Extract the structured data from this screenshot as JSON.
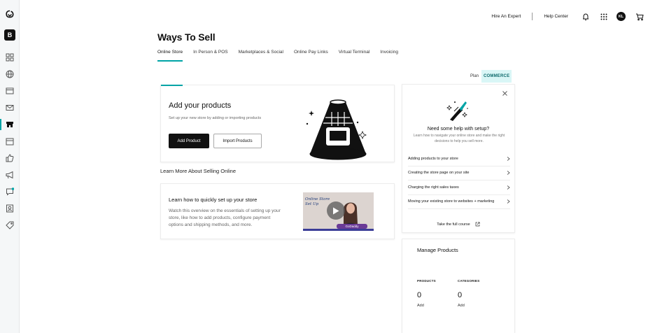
{
  "sidebar": {
    "brand_letter": "B",
    "icons": [
      "grid-icon",
      "globe-icon",
      "browser-icon",
      "mail-icon",
      "store-icon",
      "calendar-icon",
      "thumbs-up-icon",
      "megaphone-icon",
      "chat-icon",
      "contact-icon",
      "tag-icon"
    ],
    "active": "store-icon"
  },
  "header": {
    "hire_expert": "Hire An Expert",
    "help_center": "Help Center",
    "avatar_initials": "KL"
  },
  "page": {
    "title": "Ways To Sell",
    "tabs": [
      {
        "label": "Online Store",
        "active": true
      },
      {
        "label": "In Person & POS",
        "active": false
      },
      {
        "label": "Marketplaces & Social",
        "active": false
      },
      {
        "label": "Online Pay Links",
        "active": false
      },
      {
        "label": "Virtual Terminal",
        "active": false
      },
      {
        "label": "Invoicing",
        "active": false
      }
    ],
    "plan_label": "Plan",
    "plan_value": "COMMERCE"
  },
  "add_products": {
    "title": "Add your products",
    "description": "Set up your new store by adding or importing products",
    "add_button": "Add Product",
    "import_button": "Import Products"
  },
  "learn": {
    "section_title": "Learn More About Selling Online",
    "card_title": "Learn how to quickly set up your store",
    "description": "Watch this overview on the essentials of setting up your store, like how to add products, configure payment options and shipping methods, and more.",
    "video_text_1": "Online Store",
    "video_text_2": "Set Up",
    "video_brand": "GoDaddy"
  },
  "help": {
    "title": "Need some help with setup?",
    "subtitle": "Learn how to navigate your online store and make the right decisions to help you sell more.",
    "items": [
      "Adding products to your store",
      "Creating the store page on your site",
      "Charging the right sales taxes",
      "Moving your existing store to websites + marketing"
    ],
    "course_link": "Take the full course"
  },
  "manage": {
    "title": "Manage Products",
    "stats": [
      {
        "label": "PRODUCTS",
        "value": "0",
        "action": "Add"
      },
      {
        "label": "CATEGORIES",
        "value": "0",
        "action": "Add"
      }
    ]
  },
  "colors": {
    "accent": "#00a4a6",
    "badge_bg": "#d9f6f6",
    "primary_button": "#111111"
  }
}
